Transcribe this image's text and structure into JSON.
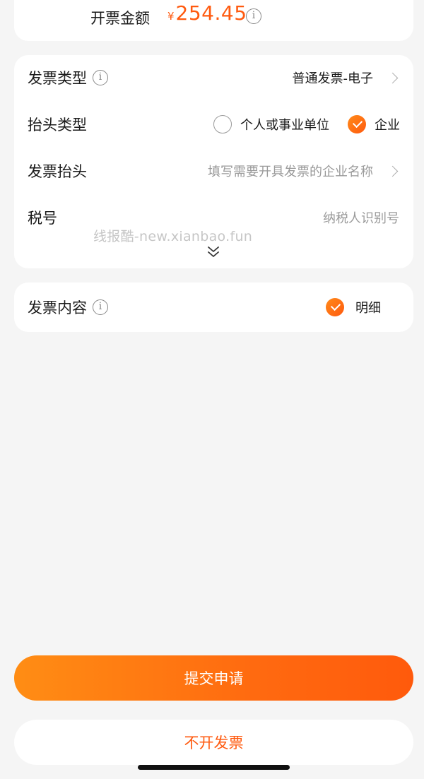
{
  "amount": {
    "label": "开票金额",
    "currency": "¥",
    "value": "254.45",
    "info_glyph": "i"
  },
  "form": {
    "invoice_type": {
      "label": "发票类型",
      "info_glyph": "i",
      "value": "普通发票-电子"
    },
    "header_type": {
      "label": "抬头类型",
      "options": [
        {
          "label": "个人或事业单位",
          "selected": false
        },
        {
          "label": "企业",
          "selected": true
        }
      ]
    },
    "invoice_title": {
      "label": "发票抬头",
      "placeholder": "填写需要开具发票的企业名称"
    },
    "tax_id": {
      "label": "税号",
      "placeholder": "纳税人识别号"
    },
    "watermark": "线报酷-new.xianbao.fun",
    "expand_icon": "double-chevron-down-icon"
  },
  "content": {
    "label": "发票内容",
    "info_glyph": "i",
    "option": {
      "label": "明细",
      "selected": true
    }
  },
  "actions": {
    "submit_label": "提交申请",
    "no_invoice_label": "不开发票"
  },
  "colors": {
    "accent": "#ff5a0f",
    "accent_light": "#ff8d14",
    "background": "#f5f5f5",
    "card": "#ffffff",
    "placeholder": "#9a9a9a"
  }
}
